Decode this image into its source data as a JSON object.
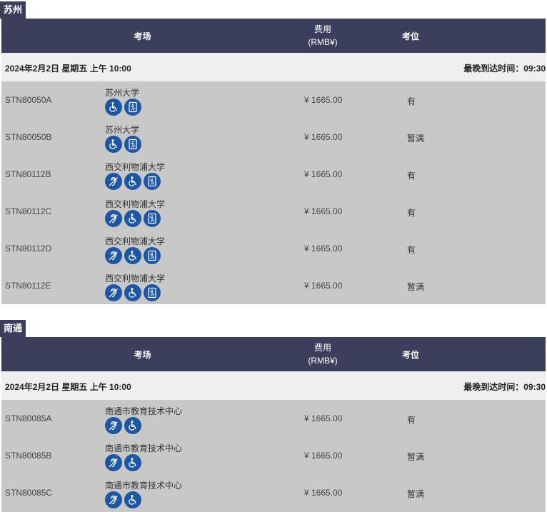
{
  "columns": {
    "venue": "考场",
    "fee_line1": "费用",
    "fee_line2": "(RMB¥)",
    "seat": "考位"
  },
  "sections": [
    {
      "city": "苏州",
      "date": "2024年2月2日 星期五 上午 10:00",
      "arrival": "最晚到达时间：09:30",
      "rows": [
        {
          "code": "STN80050A",
          "venue": "苏州大学",
          "icons": [
            "wheelchair-icon",
            "elevator-icon"
          ],
          "fee": "¥ 1665.00",
          "seat": "有"
        },
        {
          "code": "STN80050B",
          "venue": "苏州大学",
          "icons": [
            "wheelchair-icon",
            "elevator-icon"
          ],
          "fee": "¥ 1665.00",
          "seat": "暂满"
        },
        {
          "code": "STN80112B",
          "venue": "西交利物浦大学",
          "icons": [
            "hearing-icon",
            "wheelchair-icon",
            "elevator-icon"
          ],
          "fee": "¥ 1665.00",
          "seat": "有"
        },
        {
          "code": "STN80112C",
          "venue": "西交利物浦大学",
          "icons": [
            "hearing-icon",
            "wheelchair-icon",
            "elevator-icon"
          ],
          "fee": "¥ 1665.00",
          "seat": "有"
        },
        {
          "code": "STN80112D",
          "venue": "西交利物浦大学",
          "icons": [
            "hearing-icon",
            "wheelchair-icon",
            "elevator-icon"
          ],
          "fee": "¥ 1665.00",
          "seat": "有"
        },
        {
          "code": "STN80112E",
          "venue": "西交利物浦大学",
          "icons": [
            "hearing-icon",
            "wheelchair-icon",
            "elevator-icon"
          ],
          "fee": "¥ 1665.00",
          "seat": "暂满"
        }
      ]
    },
    {
      "city": "南通",
      "date": "2024年2月2日 星期五 上午 10:00",
      "arrival": "最晚到达时间：09:30",
      "rows": [
        {
          "code": "STN80085A",
          "venue": "南通市教育技术中心",
          "icons": [
            "hearing-icon",
            "wheelchair-icon"
          ],
          "fee": "¥ 1665.00",
          "seat": "有"
        },
        {
          "code": "STN80085B",
          "venue": "南通市教育技术中心",
          "icons": [
            "hearing-icon",
            "wheelchair-icon"
          ],
          "fee": "¥ 1665.00",
          "seat": "暂满"
        },
        {
          "code": "STN80085C",
          "venue": "南通市教育技术中心",
          "icons": [
            "hearing-icon",
            "wheelchair-icon"
          ],
          "fee": "¥ 1665.00",
          "seat": "暂满"
        }
      ]
    }
  ]
}
